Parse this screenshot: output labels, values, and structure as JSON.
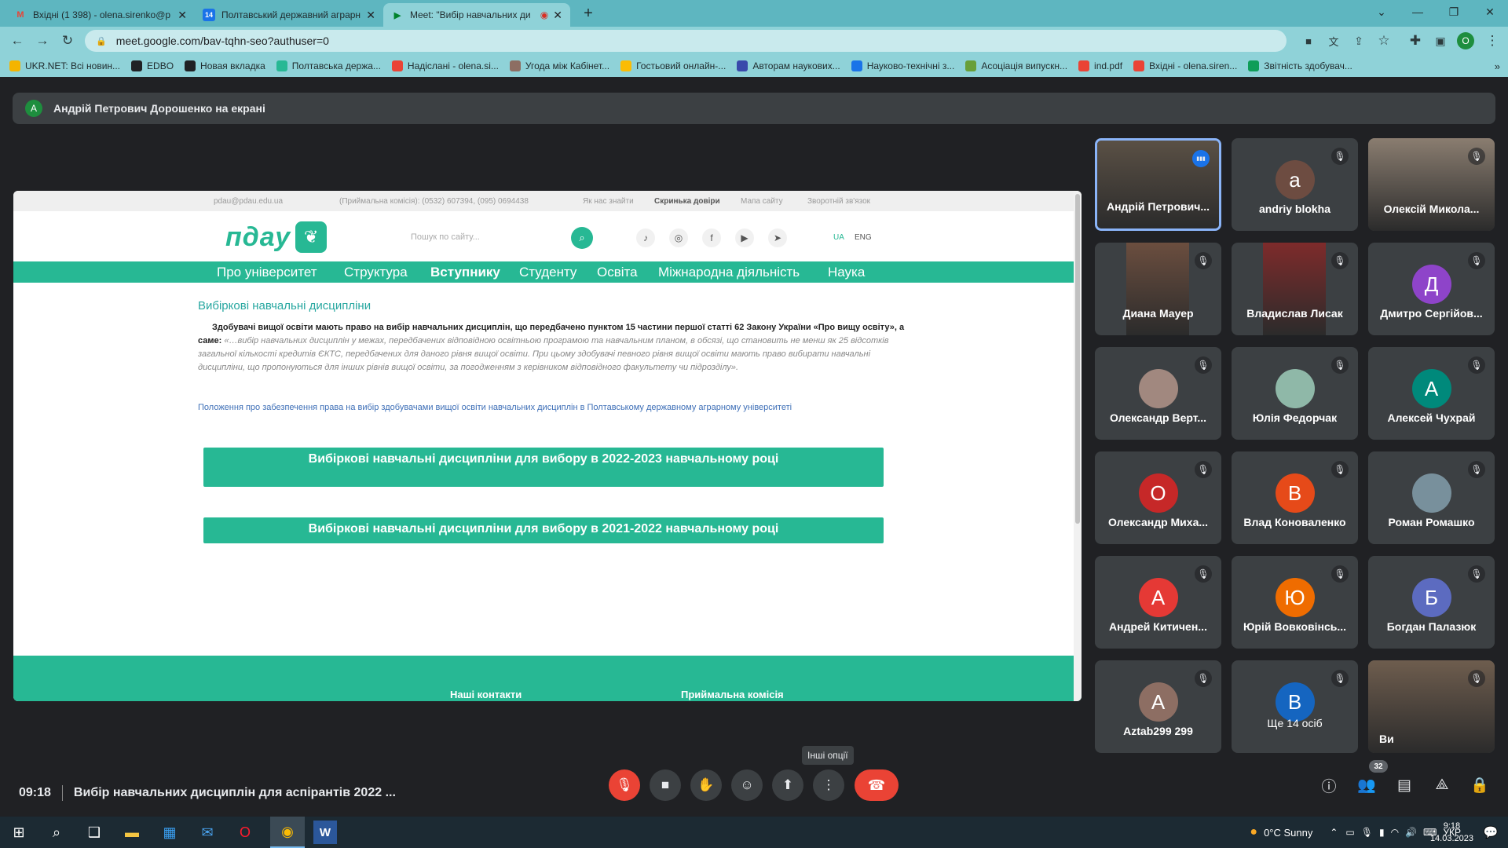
{
  "browser": {
    "tabs": [
      {
        "title": "Вхідні (1 398) - olena.sirenko@p",
        "icon": "gmail-icon"
      },
      {
        "title": "Полтавський державний аграрн",
        "icon": "calendar-icon"
      },
      {
        "title": "Meet: \"Вибір навчальних ди",
        "icon": "meet-icon"
      }
    ],
    "new_tab": "+",
    "url": "meet.google.com/bav-tqhn-seo?authuser=0",
    "profile_initial": "O",
    "bookmarks": [
      {
        "label": "UKR.NET: Всі новин...",
        "color": "#f4b400"
      },
      {
        "label": "EDBO",
        "color": "#202124"
      },
      {
        "label": "Новая вкладка",
        "color": "#202124"
      },
      {
        "label": "Полтавська держа...",
        "color": "#27b894"
      },
      {
        "label": "Надіслані - olena.si...",
        "color": "#ea4335"
      },
      {
        "label": "Угода між Кабінет...",
        "color": "#8d6e63"
      },
      {
        "label": "Гостьовий онлайн-...",
        "color": "#fbbc04"
      },
      {
        "label": "Авторам наукових...",
        "color": "#3949ab"
      },
      {
        "label": "Науково-технічні з...",
        "color": "#1a73e8"
      },
      {
        "label": "Асоціація випускн...",
        "color": "#689f38"
      },
      {
        "label": "ind.pdf",
        "color": "#ea4335"
      },
      {
        "label": "Вхідні - olena.siren...",
        "color": "#ea4335"
      },
      {
        "label": "Звітність здобувач...",
        "color": "#0f9d58"
      }
    ],
    "bookmarks_more": "»"
  },
  "meet": {
    "presenter": {
      "initial": "A",
      "text": "Андрій Петрович Дорошенко на екрані"
    },
    "shared_site": {
      "topbar": [
        "pdau@pdau.edu.ua",
        "(Приймальна комісія): (0532) 607394, (095) 0694438",
        "Як нас знайти",
        "Скринька довіри",
        "Мапа сайту",
        "Зворотній зв'язок"
      ],
      "logo": "пдау",
      "search_placeholder": "Пошук по сайту...",
      "lang_ua": "UA",
      "lang_en": "ENG",
      "nav": [
        "Про університет",
        "Структура",
        "Вступнику",
        "Студенту",
        "Освіта",
        "Міжнародна діяльність",
        "Наука"
      ],
      "heading": "Вибіркові навчальні дисципліни",
      "para_bold": "Здобувачі вищої освіти мають право на вибір навчальних дисциплін, що передбачено пунктом 15 частини першої статті 62 Закону України «Про вищу освіту», а саме:",
      "para_italic": "«…вибір навчальних дисциплін у межах, передбачених відповідною освітньою програмою та навчальним планом, в обсязі, що становить не менш як 25 відсотків загальної кількості кредитів ЄКТС, передбачених для даного рівня вищої освіти. При цьому здобувачі певного рівня вищої освіти мають право вибирати навчальні дисципліни, що пропонуються для інших рівнів вищої освіти, за погодженням з керівником відповідного факультету чи підрозділу».",
      "link": "Положення про забезпечення права на вибір здобувачами вищої освіти навчальних дисциплін в Полтавському державному аграрному університеті",
      "button_2022": "Вибіркові навчальні дисципліни для вибору в 2022-2023 навчальному році",
      "button_2021": "Вибіркові навчальні дисципліни для вибору в 2021-2022 навчальному році",
      "footer_contacts": "Наші контакти",
      "footer_admission": "Приймальна комісія"
    },
    "participants": [
      {
        "name": "Андрій Петрович...",
        "initial": "",
        "color": "",
        "video": true,
        "speaking": true
      },
      {
        "name": "andriy blokha",
        "initial": "a",
        "color": "#6d4c41",
        "video": false
      },
      {
        "name": "Олексій Микола...",
        "initial": "",
        "color": "",
        "video": true
      },
      {
        "name": "Диана Мауер",
        "initial": "",
        "color": "",
        "video": true
      },
      {
        "name": "Владислав Лисак",
        "initial": "",
        "color": "",
        "video": true
      },
      {
        "name": "Дмитро Сергійов...",
        "initial": "Д",
        "color": "#8e44c9",
        "video": false
      },
      {
        "name": "Олександр Верт...",
        "initial": "",
        "color": "#a1887f",
        "video": false
      },
      {
        "name": "Юлія Федорчак",
        "initial": "",
        "color": "#8fb8a8",
        "video": false
      },
      {
        "name": "Алексей Чухрай",
        "initial": "А",
        "color": "#00897b",
        "video": false
      },
      {
        "name": "Олександр Миха...",
        "initial": "О",
        "color": "#c62828",
        "video": false
      },
      {
        "name": "Влад Коноваленко",
        "initial": "В",
        "color": "#e64a19",
        "video": false
      },
      {
        "name": "Роман Ромашко",
        "initial": "",
        "color": "#78909c",
        "video": false
      },
      {
        "name": "Андрей Китичен...",
        "initial": "А",
        "color": "#e53935",
        "video": false
      },
      {
        "name": "Юрій Вовковінсь...",
        "initial": "Ю",
        "color": "#ef6c00",
        "video": false
      },
      {
        "name": "Богдан Палазюк",
        "initial": "Б",
        "color": "#5c6bc0",
        "video": false
      },
      {
        "name": "Aztab299 299",
        "initial": "A",
        "color": "#8d6e63",
        "video": false
      },
      {
        "name": "Ще 14 осіб",
        "initial": "B",
        "color": "#1565c0",
        "video": false
      },
      {
        "name": "Ви",
        "initial": "",
        "color": "",
        "video": true
      }
    ],
    "time": "09:18",
    "meeting_title": "Вибір навчальних дисциплін для аспірантів 2022 ...",
    "tooltip": "Інші опції",
    "participant_count": "32"
  },
  "taskbar": {
    "weather": "0°C  Sunny",
    "lang": "УКР",
    "time": "9:18",
    "date": "14.03.2023"
  }
}
